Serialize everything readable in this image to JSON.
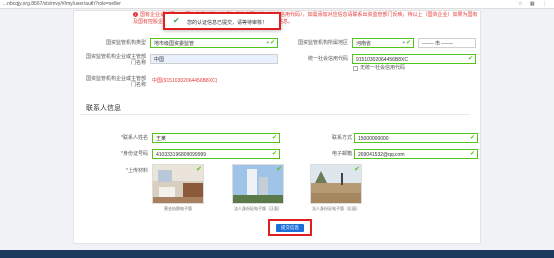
{
  "browser": {
    "url": "...nbcqjy.org.8667/xls/mvy/#/my/user/auth?role=seller",
    "icons": "☆ ▦ ⋮"
  },
  "notice": {
    "icon": "info-icon",
    "text": "国有企业请填写已在国资委系统登记的组织机构代码（统一社会信用代码），如需添加对应信息请联系出资监管部门反映，待以上（国资企业）如果为国有及国有控股企业或国有实际控制企业，应填写和确认国资监管机构信息。"
  },
  "toast": {
    "message": "您的认证信息已提交，请等待审核！"
  },
  "form": {
    "org_type_label": "国资监管机构类型",
    "org_type_value": "地市级国资委监管",
    "region_label": "国资监管机构所属地区",
    "province": "河南省",
    "city": "------- 市 -------",
    "org_name_label": "国资监管机构企业或主管部门名称",
    "org_name_value": "中国",
    "credit_code_label": "统一社会信用代码",
    "credit_code_value": "91510302064456B8XC",
    "no_credit_label": "无统一社会信用代码",
    "org_plain_label": "国资监管机构企业或主管部门名称",
    "org_plain_value": "中国(91510302064456B8XC)"
  },
  "contact": {
    "section_title": "联系人信息",
    "name_label": "*联系人姓名",
    "name_value": "王某",
    "phone_label": "联系方式",
    "phone_value": "15000000000",
    "id_label": "*身份证号码",
    "id_value": "410333196809099999",
    "email_label": "电子邮箱",
    "email_value": "269041532@qq.com",
    "upload_label": "*上传材料",
    "captions": [
      "营业执照电子版",
      "法人身份证电子版（正面）",
      "法人身份证电子版（反面）"
    ]
  },
  "submit_label": "提交信息",
  "colors": {
    "accent": "#1e6fd9",
    "success": "#52c41a",
    "danger": "#e23c39",
    "highlight_border": "#e02020"
  }
}
